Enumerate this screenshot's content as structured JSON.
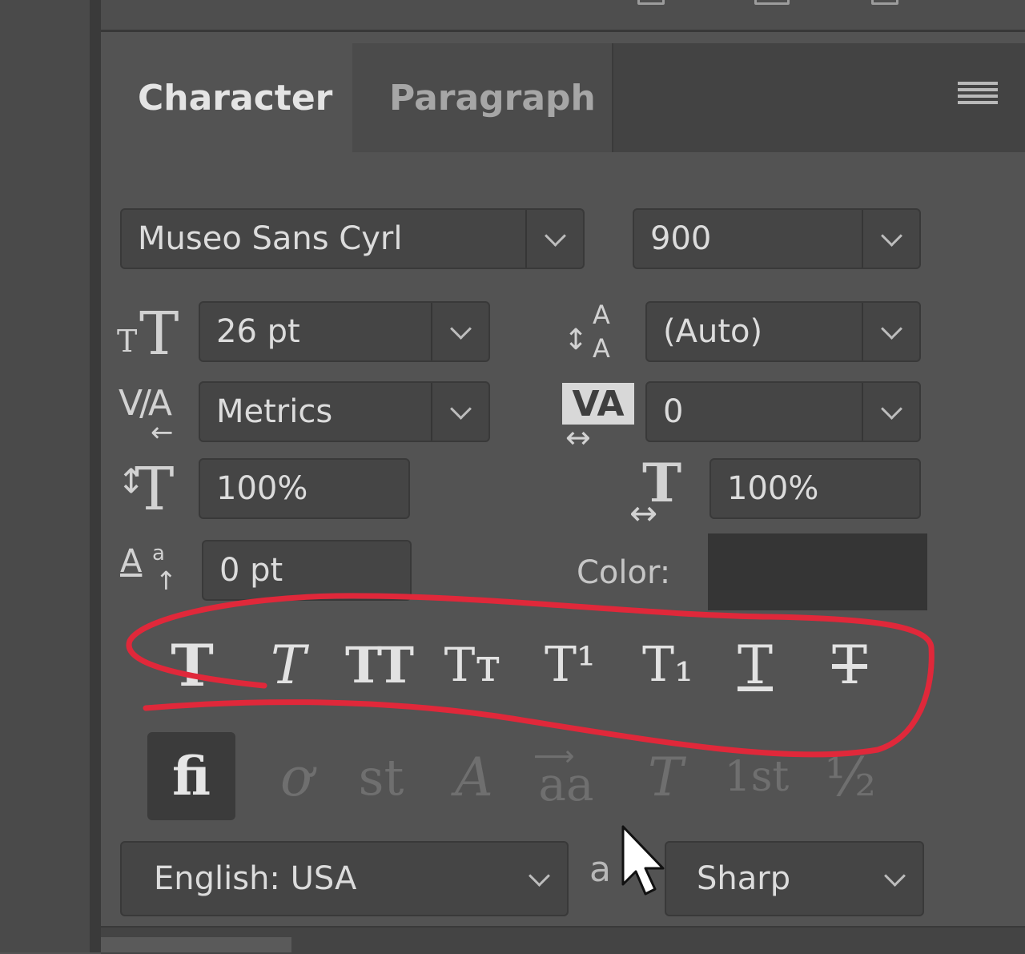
{
  "tabs": [
    {
      "label": "Character",
      "active": true
    },
    {
      "label": "Paragraph",
      "active": false
    }
  ],
  "font_family": {
    "value": "Museo Sans Cyrl"
  },
  "font_style": {
    "value": "900"
  },
  "font_size": {
    "value": "26 pt"
  },
  "leading": {
    "value": "(Auto)"
  },
  "kerning": {
    "value": "Metrics"
  },
  "tracking": {
    "value": "0"
  },
  "vertical_scale": {
    "value": "100%"
  },
  "horizontal_scale": {
    "value": "100%"
  },
  "baseline_shift": {
    "value": "0 pt"
  },
  "color": {
    "label": "Color:",
    "swatch": "#353535"
  },
  "type_style_buttons": [
    {
      "name": "faux-bold",
      "glyph": "T"
    },
    {
      "name": "faux-italic",
      "glyph": "T"
    },
    {
      "name": "all-caps",
      "glyph": "TT"
    },
    {
      "name": "small-caps",
      "glyph": "Tт"
    },
    {
      "name": "superscript",
      "glyph": "T¹"
    },
    {
      "name": "subscript",
      "glyph": "T₁"
    },
    {
      "name": "underline",
      "glyph": "T"
    },
    {
      "name": "strikethrough",
      "glyph": "T"
    }
  ],
  "opentype_buttons": [
    {
      "name": "standard-ligatures",
      "glyph": "fi",
      "active": true
    },
    {
      "name": "contextual-alternates",
      "glyph": "ơ",
      "active": false
    },
    {
      "name": "discretionary-ligatures",
      "glyph": "st",
      "active": false
    },
    {
      "name": "swash",
      "glyph": "A",
      "active": false
    },
    {
      "name": "stylistic-alternates",
      "glyph": "aa",
      "active": false
    },
    {
      "name": "titling-alternates",
      "glyph": "T",
      "active": false
    },
    {
      "name": "ordinals",
      "glyph": "1st",
      "active": false
    },
    {
      "name": "fractions",
      "glyph": "½",
      "active": false
    }
  ],
  "language": {
    "value": "English: USA"
  },
  "anti_alias": {
    "value": "Sharp",
    "icon_glyph": "a"
  },
  "accent_color": "#e0283a"
}
